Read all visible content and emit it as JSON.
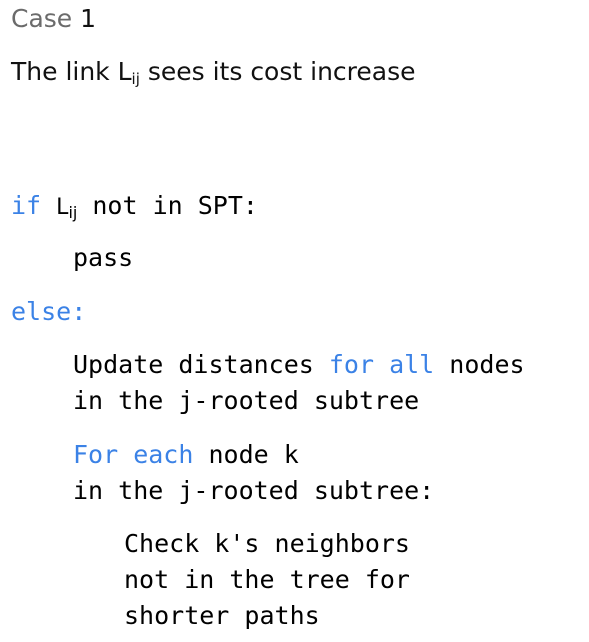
{
  "case_title": {
    "label": "Case",
    "number": "1"
  },
  "description": {
    "before": "The link L",
    "subscript": "ij",
    "after": " sees its cost increase"
  },
  "code": {
    "if_keyword": "if",
    "if_var": "L",
    "if_var_sub": "ij",
    "if_rest": " not in SPT:",
    "pass": "pass",
    "else": "else:",
    "update_text": "Update distances ",
    "update_kw": "for all",
    "update_rest": " nodes",
    "update_line2": "in the j-rooted subtree",
    "foreach_kw": "For each",
    "foreach_rest": " node k",
    "foreach_line2": "in the j-rooted subtree:",
    "check_line1": "Check k's neighbors",
    "check_line2": "not in the tree for",
    "check_line3": "shorter paths"
  },
  "colors": {
    "keyword": "#3b82e6",
    "text": "#000000",
    "muted": "#6b6b6b"
  }
}
